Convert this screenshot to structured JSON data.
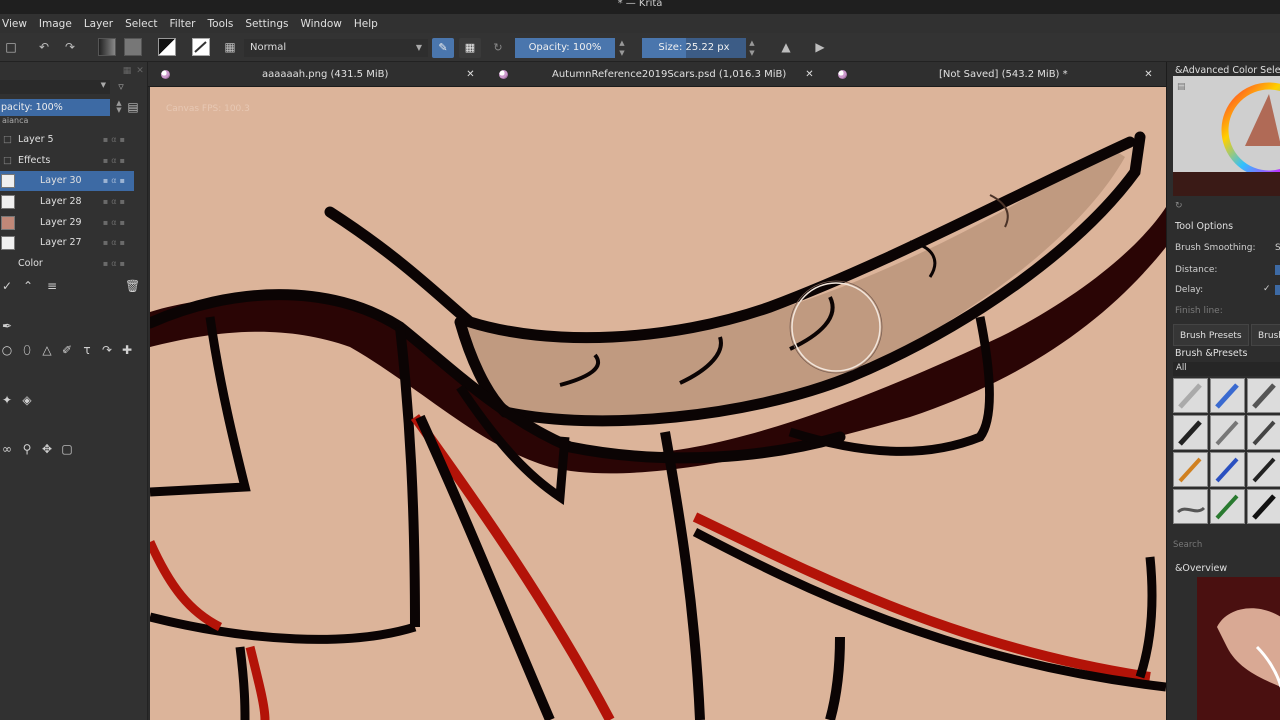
{
  "window": {
    "title": "* — Krita"
  },
  "menu": [
    "View",
    "Image",
    "Layer",
    "Select",
    "Filter",
    "Tools",
    "Settings",
    "Window",
    "Help"
  ],
  "toolbar": {
    "blend_mode": "Normal",
    "opacity_label": "Opacity: 100%",
    "opacity_fraction": 1.0,
    "size_label": "Size: 25.22 px"
  },
  "layers": {
    "opacity_label": "pacity: 100%",
    "partial_top": "aianca",
    "rows": [
      {
        "name": "Layer 5"
      },
      {
        "name": "Effects"
      },
      {
        "name": "Layer 30",
        "selected": true
      },
      {
        "name": "Layer 28"
      },
      {
        "name": "Layer 29"
      },
      {
        "name": "Layer 27"
      },
      {
        "name": "Color"
      }
    ]
  },
  "tabs": [
    {
      "label": "aaaaaah.png (431.5 MiB)"
    },
    {
      "label": "AutumnReference2019Scars.psd (1,016.3 MiB)"
    },
    {
      "label": "[Not Saved] (543.2 MiB) *"
    }
  ],
  "canvas": {
    "fps": "Canvas FPS: 100.3"
  },
  "right_dock": {
    "color_selector_title": "&Advanced Color Selector",
    "tool_options_title": "Tool Options",
    "brush_smoothing": "Brush Smoothing:",
    "brush_smoothing_value": "S",
    "distance": "Distance:",
    "delay": "Delay:",
    "finish_line": "Finish line:",
    "tab_brush_presets": "Brush Presets",
    "tab_brush": "Brush",
    "brush_presets_title": "Brush &Presets",
    "filter_all": "All",
    "search": "Search",
    "overview_title": "&Overview"
  },
  "colors": {
    "accent": "#3d6aa4",
    "skin": "#dcb49a",
    "horn": "#c09a80",
    "dark_red": "#2a0505",
    "red": "#b31308"
  }
}
